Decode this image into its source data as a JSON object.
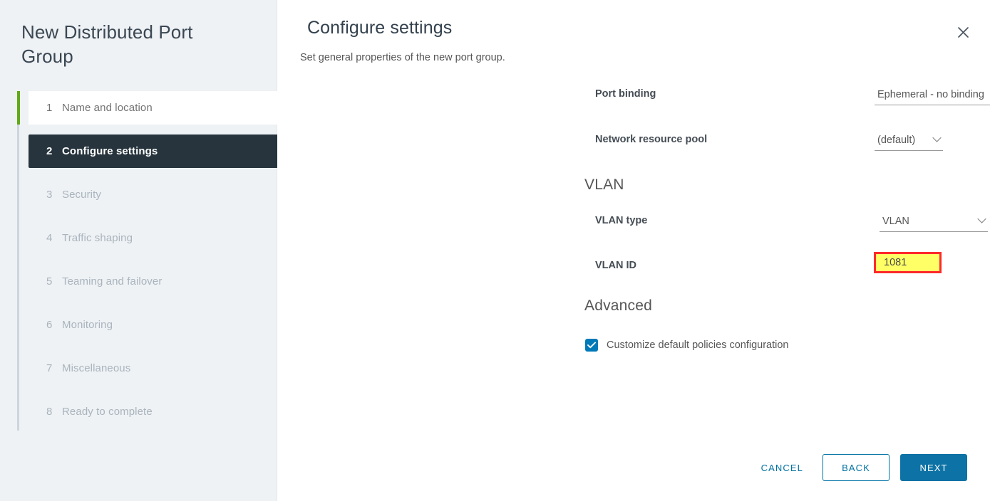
{
  "wizard": {
    "title": "New Distributed Port Group",
    "steps": [
      {
        "num": "1",
        "label": "Name and location",
        "state": "completed"
      },
      {
        "num": "2",
        "label": "Configure settings",
        "state": "active"
      },
      {
        "num": "3",
        "label": "Security",
        "state": "upcoming"
      },
      {
        "num": "4",
        "label": "Traffic shaping",
        "state": "upcoming"
      },
      {
        "num": "5",
        "label": "Teaming and failover",
        "state": "upcoming"
      },
      {
        "num": "6",
        "label": "Monitoring",
        "state": "upcoming"
      },
      {
        "num": "7",
        "label": "Miscellaneous",
        "state": "upcoming"
      },
      {
        "num": "8",
        "label": "Ready to complete",
        "state": "upcoming"
      }
    ]
  },
  "header": {
    "title": "Configure settings",
    "subtitle": "Set general properties of the new port group.",
    "close_icon": "close-icon"
  },
  "form": {
    "port_binding": {
      "label": "Port binding",
      "value": "Ephemeral - no binding",
      "caret_icon": "chevron-down-icon"
    },
    "network_resource_pool": {
      "label": "Network resource pool",
      "value": "(default)",
      "caret_icon": "chevron-down-icon"
    },
    "vlan_section": "VLAN",
    "vlan_type": {
      "label": "VLAN type",
      "value": "VLAN",
      "caret_icon": "chevron-down-icon"
    },
    "vlan_id": {
      "label": "VLAN ID",
      "value": "1081",
      "highlight_border": "#fc2a2a",
      "highlight_fill": "#ffff66"
    },
    "advanced_section": "Advanced",
    "customize_policies": {
      "label": "Customize default policies configuration",
      "checked": true,
      "check_icon": "check-icon",
      "accent": "#0079b8"
    }
  },
  "footer": {
    "cancel": "CANCEL",
    "back": "BACK",
    "next": "NEXT",
    "accent": "#0072a3",
    "primary_bg": "#0d72a5"
  }
}
